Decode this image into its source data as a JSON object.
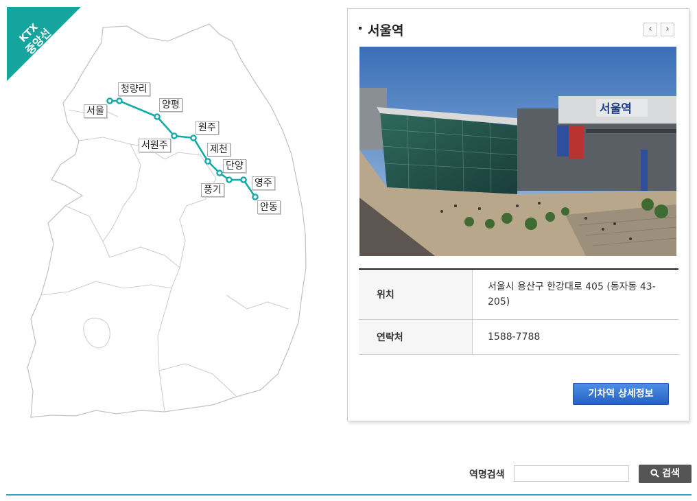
{
  "map": {
    "line_name": "KTX 중앙선",
    "line_color": "#13a9a6",
    "stations": [
      {
        "name": "서울"
      },
      {
        "name": "청량리"
      },
      {
        "name": "양평"
      },
      {
        "name": "서원주"
      },
      {
        "name": "원주"
      },
      {
        "name": "제천"
      },
      {
        "name": "단양"
      },
      {
        "name": "풍기"
      },
      {
        "name": "영주"
      },
      {
        "name": "안동"
      }
    ]
  },
  "panel": {
    "title": "서울역",
    "prev_icon": "chevron-left-icon",
    "next_icon": "chevron-right-icon",
    "photo_sign_text": "서울역",
    "info": [
      {
        "label": "위치",
        "value": "서울시 용산구 한강대로 405 (동자동 43-205)"
      },
      {
        "label": "연락처",
        "value": "1588-7788"
      }
    ],
    "detail_button": "기차역 상세정보",
    "detail_button_color": "#2a6ccf"
  },
  "search": {
    "label": "역명검색",
    "input_value": "",
    "button_label": "검색",
    "button_icon": "search-icon"
  },
  "colors": {
    "accent_line": "#31a3c4",
    "ribbon": "#16a59e"
  }
}
